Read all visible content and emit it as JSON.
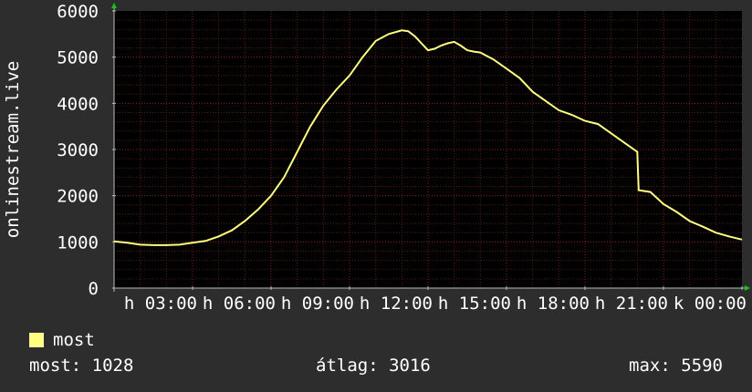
{
  "colors": {
    "background": "#2d2d2d",
    "plot_background": "#000000",
    "grid": "#5a1a1a",
    "grid_major": "#7a2020",
    "line": "#ffff80",
    "axis_text": "#ffffff",
    "arrow": "#19c219"
  },
  "chart_data": {
    "type": "line",
    "ylabel": "onlinestream.live",
    "ylim": [
      0,
      6000
    ],
    "y_ticks": [
      0,
      1000,
      2000,
      3000,
      4000,
      5000,
      6000
    ],
    "x_tick_labels": [
      "h 03:00",
      "h 06:00",
      "h 09:00",
      "h 12:00",
      "h 15:00",
      "h 18:00",
      "h 21:00",
      "k 00:00"
    ],
    "x_hours": [
      0,
      0.5,
      1,
      1.5,
      2,
      2.5,
      3,
      3.5,
      4,
      4.5,
      5,
      5.5,
      6,
      6.5,
      7,
      7.5,
      8,
      8.5,
      9,
      9.5,
      10,
      10.5,
      11,
      11.25,
      11.5,
      11.75,
      12,
      12.25,
      12.5,
      12.75,
      13,
      13.25,
      13.5,
      13.75,
      14,
      14.5,
      15,
      15.5,
      16,
      16.5,
      17,
      17.5,
      18,
      18.5,
      19,
      19.5,
      20,
      20.05,
      20.5,
      21,
      21.5,
      22,
      22.5,
      23,
      23.5,
      24
    ],
    "series": [
      {
        "name": "most",
        "values": [
          1010,
          980,
          940,
          930,
          930,
          940,
          980,
          1020,
          1120,
          1250,
          1450,
          1700,
          2000,
          2400,
          2950,
          3500,
          3950,
          4300,
          4600,
          5000,
          5350,
          5500,
          5580,
          5560,
          5450,
          5300,
          5150,
          5180,
          5250,
          5300,
          5330,
          5250,
          5150,
          5120,
          5100,
          4950,
          4750,
          4550,
          4250,
          4050,
          3850,
          3750,
          3620,
          3550,
          3350,
          3150,
          2950,
          2120,
          2080,
          1820,
          1650,
          1450,
          1330,
          1200,
          1120,
          1050,
          1010
        ]
      }
    ]
  },
  "legend": {
    "label": "most"
  },
  "stats": {
    "now": "most: 1028",
    "avg": "átlag: 3016",
    "max": "max: 5590"
  }
}
